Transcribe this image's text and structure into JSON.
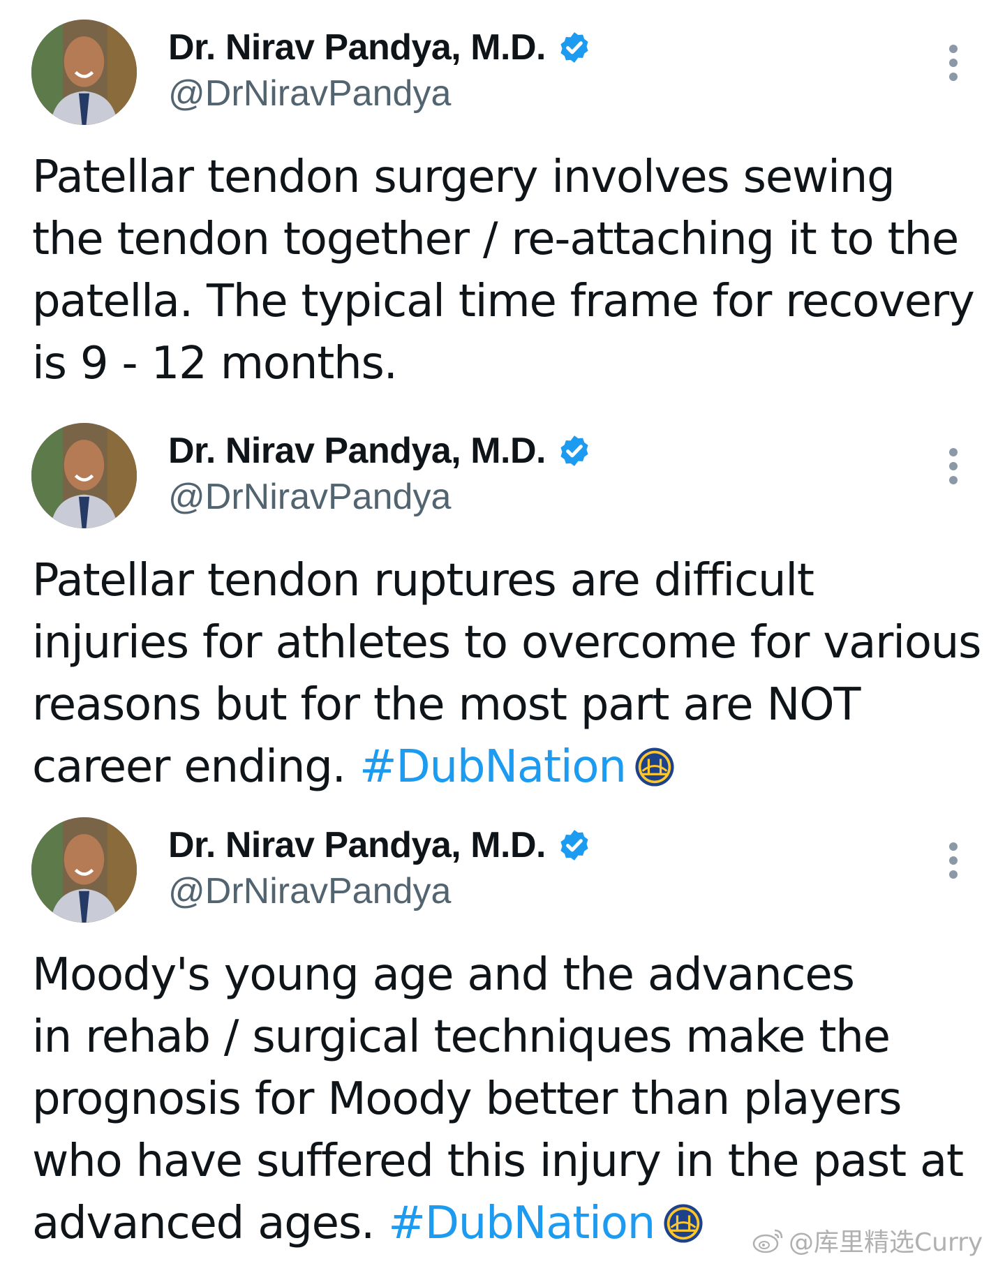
{
  "tweets": [
    {
      "display_name": "Dr. Nirav Pandya, M.D.",
      "handle": "@DrNiravPandya",
      "verified_icon": "verified-badge-icon",
      "text_lines": [
        "Patellar tendon surgery involves sewing",
        "the tendon together / re-attaching it to the",
        "patella.  The typical time frame for recovery",
        "is 9 - 12 months."
      ]
    },
    {
      "display_name": "Dr. Nirav Pandya, M.D.",
      "handle": "@DrNiravPandya",
      "verified_icon": "verified-badge-icon",
      "text_lines": [
        "Patellar tendon ruptures are difficult",
        "injuries for athletes to overcome for various",
        "reasons but for the most part are NOT"
      ],
      "last_line_text": "career ending. ",
      "hashtag": "#DubNation",
      "emoji": "warriors-logo-icon"
    },
    {
      "display_name": "Dr. Nirav Pandya, M.D.",
      "handle": "@DrNiravPandya",
      "verified_icon": "verified-badge-icon",
      "text_lines": [
        "Moody's young age and the advances",
        "in rehab / surgical techniques make the",
        "prognosis for Moody better than players",
        "who have suffered this injury in the past at"
      ],
      "last_line_text": "advanced ages. ",
      "hashtag": "#DubNation",
      "emoji": "warriors-logo-icon"
    }
  ],
  "watermark": {
    "text": "@库里精选Curry",
    "icon": "weibo-icon"
  },
  "colors": {
    "text": "#0f1419",
    "handle": "#536471",
    "hashtag": "#1d9bf0",
    "verified": "#1d9bf0",
    "warriors_blue": "#1d428a",
    "warriors_gold": "#ffc72c"
  }
}
